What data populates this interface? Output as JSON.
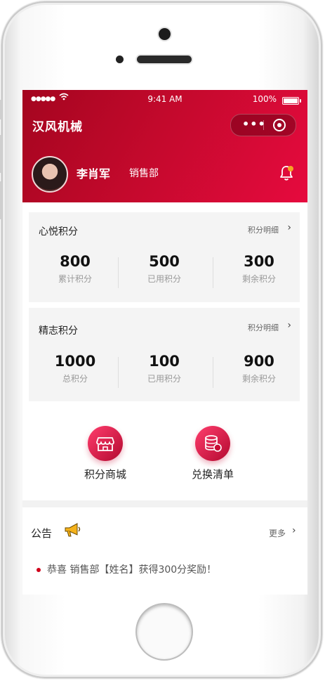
{
  "status_bar": {
    "signal": "●●●●●",
    "wifi": "wifi-icon",
    "time": "9:41 AM",
    "battery": "100%"
  },
  "header": {
    "app_title": "汉风机械",
    "capsule_more": "•••",
    "user_name": "李肖军",
    "department": "销售部",
    "accent_color": "#c3092c"
  },
  "cards": [
    {
      "title": "心悦积分",
      "link": "积分明细",
      "stats": [
        {
          "value": "800",
          "label": "累计积分"
        },
        {
          "value": "500",
          "label": "已用积分"
        },
        {
          "value": "300",
          "label": "剩余积分"
        }
      ]
    },
    {
      "title": "精志积分",
      "link": "积分明细",
      "stats": [
        {
          "value": "1000",
          "label": "总积分"
        },
        {
          "value": "100",
          "label": "已用积分"
        },
        {
          "value": "900",
          "label": "剩余积分"
        }
      ]
    }
  ],
  "actions": [
    {
      "label": "积分商城",
      "icon": "store-icon"
    },
    {
      "label": "兑换清单",
      "icon": "coins-icon"
    }
  ],
  "notice": {
    "title": "公告",
    "icon": "megaphone-icon",
    "more": "更多",
    "items": [
      "恭喜 销售部【姓名】获得300分奖励！"
    ]
  }
}
